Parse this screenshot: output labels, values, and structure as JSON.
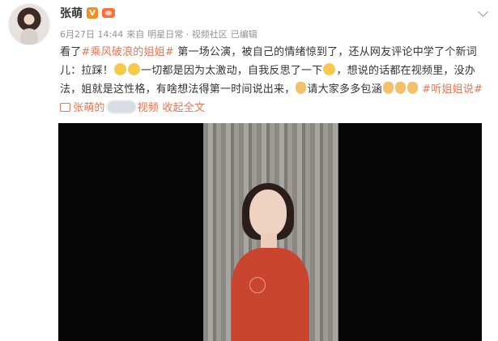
{
  "post": {
    "username": "张萌",
    "vip_badge": "V",
    "date": "6月27日 14:44",
    "source_prefix": "来自",
    "source": "明星日常 · 视频社区",
    "edited": "已编辑",
    "text_1": "看了",
    "hashtag_1": "#乘风破浪的姐姐#",
    "text_2": " 第一场公演，被自己的情绪惊到了，还从网友评论中学了个新词儿：拉踩！",
    "text_3": "一切都是因为太激动，自我反思了一下",
    "text_4": "，想说的话都在视频里，没办法，姐就是这性格，有啥想法得第一时间说出来，",
    "text_5": "请大家多多包涵",
    "hashtag_2": "#听姐姐说#",
    "video_link_1": "张萌的",
    "video_link_2": "视频",
    "collapse": "收起全文"
  },
  "icons": {
    "avatar": "avatar-photo",
    "vip": "verified-badge-icon",
    "member": "member-badge-icon",
    "menu": "chevron-down-icon",
    "video": "video-link-icon"
  },
  "colors": {
    "link": "#eb7350",
    "meta": "#939393",
    "text": "#333333"
  }
}
